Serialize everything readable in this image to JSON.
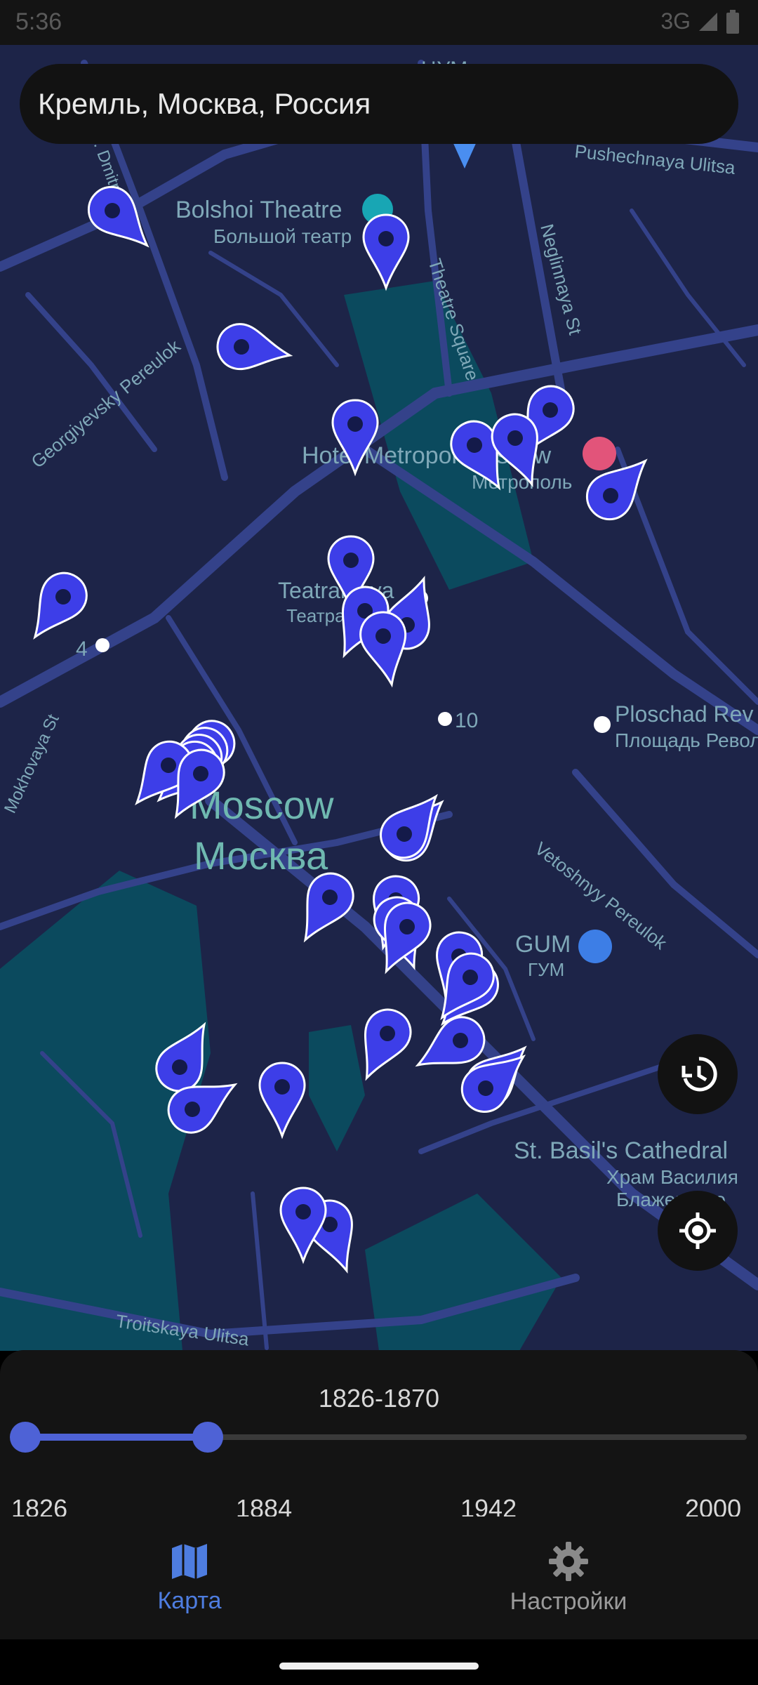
{
  "status_bar": {
    "time": "5:36",
    "network": "3G"
  },
  "search": {
    "value": "Кремль, Москва, Россия"
  },
  "map": {
    "labels": {
      "tsum": "ЦУМ",
      "pushechnaya": "Pushechnaya Ulitsa",
      "bolshoi_en": "Bolshoi Theatre",
      "bolshoi_ru": "Большой театр",
      "theatre_square": "Theatre Square",
      "neglinnaya": "Neglinnaya St",
      "georgiyevsky": "Georgiyevsky Pereulok",
      "metropol_en": "Hotel Metropol Moscow",
      "metropol_ru": "Метрополь",
      "teatralnaya_en": "Teatralnaya",
      "teatralnaya_ru": "Театральная",
      "metro_4": "4",
      "metro_10": "10",
      "ploschad_en": "Ploschad Rev",
      "ploschad_ru": "Площадь Револ",
      "mokhovaya": "Mokhovaya St",
      "moscow_en": "Moscow",
      "moscow_ru": "Москва",
      "vetoshnyy": "Vetoshnyy Pereulok",
      "gum_en": "GUM",
      "gum_ru": "ГУМ",
      "stbasil_en": "St. Basil's Cathedral",
      "stbasil_ru_1": "Храм Василия",
      "stbasil_ru_2": "Блаженного",
      "troitskaya": "Troitskaya Ulitsa",
      "dmitrovka": "B. Dmitrovka"
    },
    "marker_icon": "map-pin-icon"
  },
  "timeline": {
    "selected_range": "1826-1870",
    "min": 1826,
    "max": 2000,
    "range_start": 1826,
    "range_end": 1870,
    "ticks": [
      "1826",
      "1884",
      "1942",
      "2000"
    ]
  },
  "nav": {
    "items": [
      {
        "label": "Карта",
        "icon": "map-icon",
        "active": true
      },
      {
        "label": "Настройки",
        "icon": "gear-icon",
        "active": false
      }
    ]
  },
  "colors": {
    "map_background": "#1d2448",
    "road": "#34428a",
    "park": "#0b4a5e",
    "marker": "#3d3ee8",
    "accent": "#4e62d6",
    "label_text": "#7fa8b8"
  },
  "fabs": {
    "history_icon": "history-icon",
    "locate_icon": "my-location-icon"
  }
}
